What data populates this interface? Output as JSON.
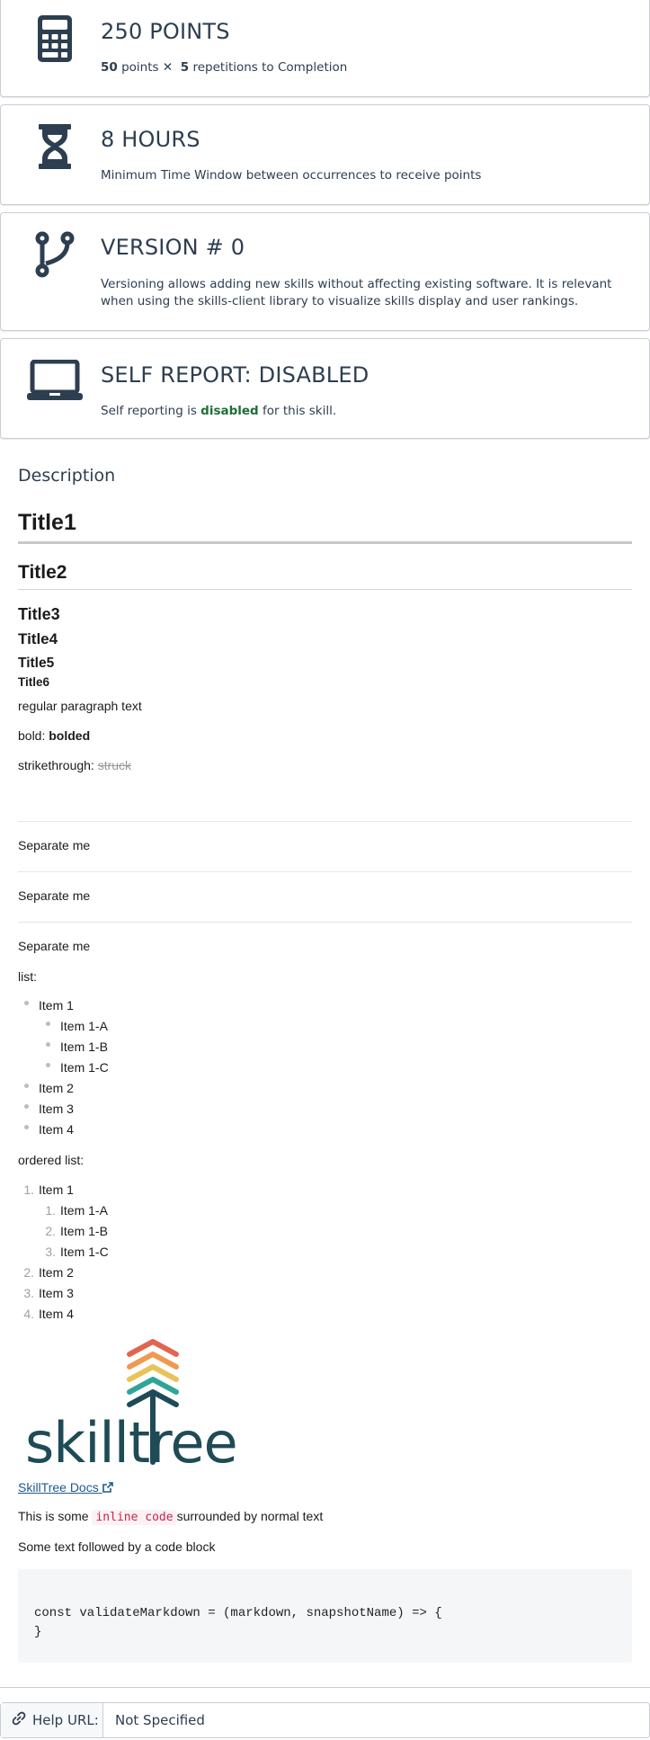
{
  "cards": {
    "points": {
      "title": "250 POINTS",
      "points_value": "50",
      "points_word": "points",
      "times_symbol": "✕",
      "reps_value": "5",
      "reps_text": "repetitions to Completion",
      "icon": "calculator-icon"
    },
    "hours": {
      "title": "8 HOURS",
      "subtitle": "Minimum Time Window between occurrences to receive points",
      "icon": "hourglass-icon"
    },
    "version": {
      "title": "VERSION # 0",
      "subtitle": "Versioning allows adding new skills without affecting existing software. It is relevant when using the skills-client library to visualize skills display and user rankings.",
      "icon": "code-branch-icon"
    },
    "self_report": {
      "title": "SELF REPORT: DISABLED",
      "prefix": "Self reporting is",
      "status": "disabled",
      "suffix": "for this skill.",
      "icon": "laptop-icon"
    }
  },
  "description": {
    "label": "Description",
    "h1": "Title1",
    "h2": "Title2",
    "h3": "Title3",
    "h4": "Title4",
    "h5": "Title5",
    "h6": "Title6",
    "paragraph": "regular paragraph text",
    "bold_label": "bold:",
    "bold_value": "bolded",
    "strike_label": "strikethrough:",
    "strike_value": "struck",
    "separators": [
      "Separate me",
      "Separate me",
      "Separate me"
    ],
    "list_label": "list:",
    "list": [
      "Item 1",
      "Item 1-A",
      "Item 1-B",
      "Item 1-C",
      "Item 2",
      "Item 3",
      "Item 4"
    ],
    "ordered_label": "ordered list:",
    "ordered": [
      "Item 1",
      "Item 1-A",
      "Item 1-B",
      "Item 1-C",
      "Item 2",
      "Item 3",
      "Item 4"
    ],
    "ordered_numbers": [
      "1.",
      "1.",
      "2.",
      "3.",
      "2.",
      "3.",
      "4."
    ],
    "logo_text": "skilltree",
    "link_text": "SkillTree Docs",
    "inline_before": "This is some",
    "inline_code": "inline code",
    "inline_after": "surrounded by normal text",
    "codeblock_intro": "Some text followed by a code block",
    "code_line1": "const validateMarkdown = (markdown, snapshotName) => {",
    "code_line2": "}"
  },
  "help": {
    "label": "Help URL:",
    "value": "Not Specified"
  },
  "colors": {
    "text": "#2d3e50",
    "disabled_green": "#1e6e37",
    "link": "#1e5a8c",
    "inline_code": "#c7254e",
    "logo_dark": "#1f4b56",
    "chevron_red": "#e2654f",
    "chevron_orange": "#ef9a52",
    "chevron_yellow": "#e8c35a",
    "chevron_teal": "#2fa598"
  }
}
